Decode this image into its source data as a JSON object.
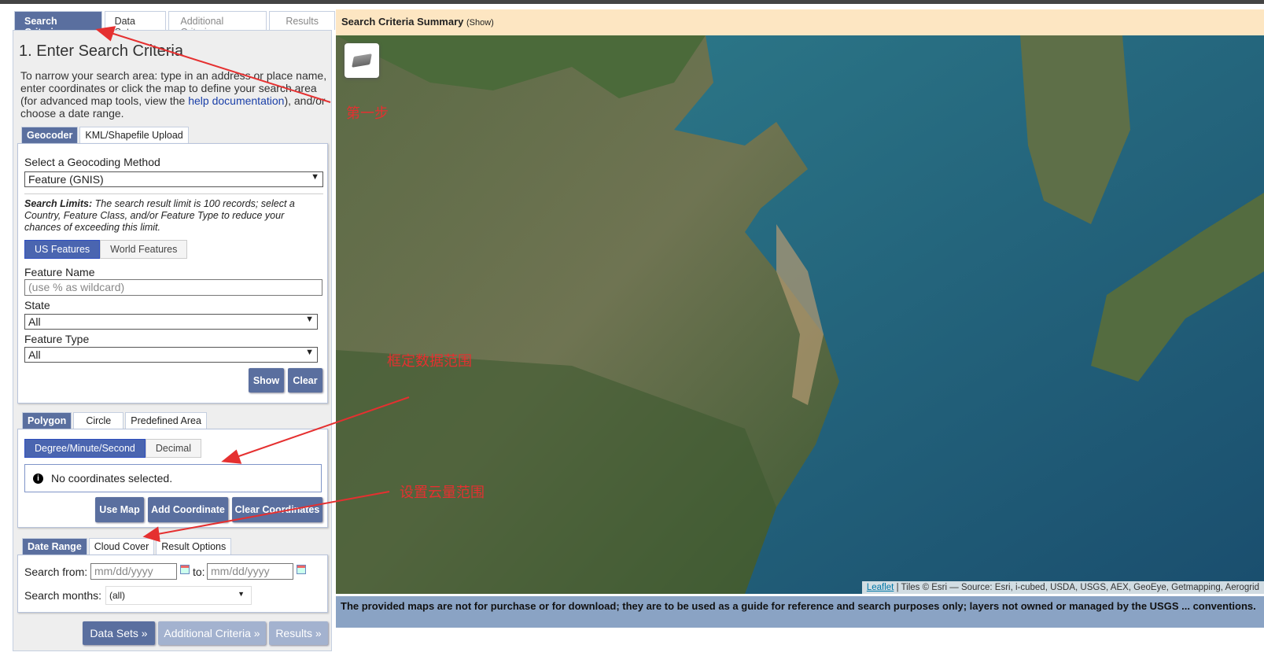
{
  "main_tabs": [
    "Search Criteria",
    "Data Sets",
    "Additional Criteria",
    "Results"
  ],
  "heading": "1. Enter Search Criteria",
  "intro": {
    "before": "To narrow your search area: type in an address or place name, enter coordinates or click the map to define your search area (for advanced map tools, view the ",
    "link": "help documentation",
    "after": "), and/or choose a date range."
  },
  "geo_tabs": [
    "Geocoder",
    "KML/Shapefile Upload"
  ],
  "geocoder": {
    "method_label": "Select a Geocoding Method",
    "method_value": "Feature (GNIS)",
    "limits_bold": "Search Limits:",
    "limits_text": " The search result limit is 100 records; select a Country, Feature Class, and/or Feature Type to reduce your chances of exceeding this limit.",
    "feature_toggle": [
      "US Features",
      "World Features"
    ],
    "feature_name_label": "Feature Name",
    "feature_name_placeholder": "(use % as wildcard)",
    "state_label": "State",
    "state_value": "All",
    "type_label": "Feature Type",
    "type_value": "All",
    "show": "Show",
    "clear": "Clear"
  },
  "area_tabs": [
    "Polygon",
    "Circle",
    "Predefined Area"
  ],
  "polygon": {
    "format_toggle": [
      "Degree/Minute/Second",
      "Decimal"
    ],
    "message": "No coordinates selected.",
    "use_map": "Use Map",
    "add": "Add Coordinate",
    "clear": "Clear Coordinates"
  },
  "date_tabs": [
    "Date Range",
    "Cloud Cover",
    "Result Options"
  ],
  "date": {
    "from_label": "Search from:",
    "from_placeholder": "mm/dd/yyyy",
    "to_label": "to:",
    "to_placeholder": "mm/dd/yyyy",
    "months_label": "Search months:",
    "months_value": "(all)"
  },
  "nav_buttons": [
    "Data Sets »",
    "Additional Criteria »",
    "Results »"
  ],
  "summary": {
    "title": "Search Criteria Summary",
    "show": "(Show)"
  },
  "attribution": {
    "link": "Leaflet",
    "text": " | Tiles © Esri — Source: Esri, i-cubed, USDA, USGS, AEX, GeoEye, Getmapping, Aerogrid"
  },
  "disclaimer": "The provided maps are not for purchase or for download; they are to be used as a guide for reference and search purposes only; layers not owned or managed by the USGS ... conventions.",
  "annotations": [
    "第一步",
    "框定数据范围",
    "设置云量范围"
  ]
}
